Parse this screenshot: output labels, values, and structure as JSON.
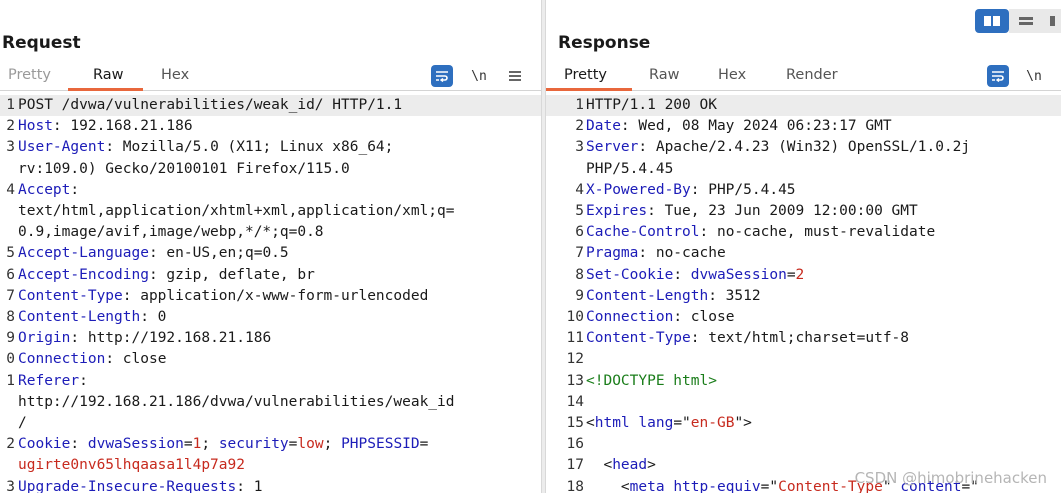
{
  "request": {
    "title": "Request",
    "tabs": [
      "Pretty",
      "Raw",
      "Hex"
    ],
    "active_tab": "Raw",
    "icons": {
      "wrap": "wrap-lines-icon",
      "newline": "\\n",
      "menu": "menu-icon"
    },
    "lines": [
      {
        "n": "1",
        "parts": [
          {
            "t": "POST /dvwa/vulnerabilities/weak_id/ HTTP/1.1",
            "c": "txt"
          }
        ],
        "hl": true
      },
      {
        "n": "2",
        "parts": [
          {
            "t": "Host",
            "c": "k"
          },
          {
            "t": ": 192.168.21.186",
            "c": "txt"
          }
        ]
      },
      {
        "n": "3",
        "parts": [
          {
            "t": "User-Agent",
            "c": "k"
          },
          {
            "t": ": Mozilla/5.0 (X11; Linux x86_64;",
            "c": "txt"
          }
        ]
      },
      {
        "n": "",
        "parts": [
          {
            "t": "rv:109.0) Gecko/20100101 Firefox/115.0",
            "c": "txt"
          }
        ]
      },
      {
        "n": "4",
        "parts": [
          {
            "t": "Accept",
            "c": "k"
          },
          {
            "t": ":",
            "c": "txt"
          }
        ]
      },
      {
        "n": "",
        "parts": [
          {
            "t": "text/html,application/xhtml+xml,application/xml;q=",
            "c": "txt"
          }
        ]
      },
      {
        "n": "",
        "parts": [
          {
            "t": "0.9,image/avif,image/webp,*/*;q=0.8",
            "c": "txt"
          }
        ]
      },
      {
        "n": "5",
        "parts": [
          {
            "t": "Accept-Language",
            "c": "k"
          },
          {
            "t": ": en-US,en;q=0.5",
            "c": "txt"
          }
        ]
      },
      {
        "n": "6",
        "parts": [
          {
            "t": "Accept-Encoding",
            "c": "k"
          },
          {
            "t": ": gzip, deflate, br",
            "c": "txt"
          }
        ]
      },
      {
        "n": "7",
        "parts": [
          {
            "t": "Content-Type",
            "c": "k"
          },
          {
            "t": ": application/x-www-form-urlencoded",
            "c": "txt"
          }
        ]
      },
      {
        "n": "8",
        "parts": [
          {
            "t": "Content-Length",
            "c": "k"
          },
          {
            "t": ": 0",
            "c": "txt"
          }
        ]
      },
      {
        "n": "9",
        "parts": [
          {
            "t": "Origin",
            "c": "k"
          },
          {
            "t": ": http://192.168.21.186",
            "c": "txt"
          }
        ]
      },
      {
        "n": "0",
        "parts": [
          {
            "t": "Connection",
            "c": "k"
          },
          {
            "t": ": close",
            "c": "txt"
          }
        ]
      },
      {
        "n": "1",
        "parts": [
          {
            "t": "Referer",
            "c": "k"
          },
          {
            "t": ":",
            "c": "txt"
          }
        ]
      },
      {
        "n": "",
        "parts": [
          {
            "t": "http://192.168.21.186/dvwa/vulnerabilities/weak_id",
            "c": "txt"
          }
        ]
      },
      {
        "n": "",
        "parts": [
          {
            "t": "/",
            "c": "txt"
          }
        ]
      },
      {
        "n": "2",
        "parts": [
          {
            "t": "Cookie",
            "c": "k"
          },
          {
            "t": ": ",
            "c": "txt"
          },
          {
            "t": "dvwaSession",
            "c": "k"
          },
          {
            "t": "=",
            "c": "txt"
          },
          {
            "t": "1",
            "c": "v"
          },
          {
            "t": "; ",
            "c": "txt"
          },
          {
            "t": "security",
            "c": "k"
          },
          {
            "t": "=",
            "c": "txt"
          },
          {
            "t": "low",
            "c": "v"
          },
          {
            "t": "; ",
            "c": "txt"
          },
          {
            "t": "PHPSESSID",
            "c": "k"
          },
          {
            "t": "=",
            "c": "txt"
          }
        ]
      },
      {
        "n": "",
        "parts": [
          {
            "t": "ugirte0nv65lhqaasa1l4p7a92",
            "c": "v"
          }
        ]
      },
      {
        "n": "3",
        "parts": [
          {
            "t": "Upgrade-Insecure-Requests",
            "c": "k"
          },
          {
            "t": ": 1",
            "c": "txt"
          }
        ]
      }
    ]
  },
  "response": {
    "title": "Response",
    "tabs": [
      "Pretty",
      "Raw",
      "Hex",
      "Render"
    ],
    "active_tab": "Pretty",
    "icons": {
      "wrap": "wrap-lines-icon",
      "newline": "\\n"
    },
    "lines": [
      {
        "n": "1",
        "parts": [
          {
            "t": "HTTP/1.1 200 OK",
            "c": "txt"
          }
        ],
        "hl": true
      },
      {
        "n": "2",
        "parts": [
          {
            "t": "Date",
            "c": "k"
          },
          {
            "t": ": Wed, 08 May 2024 06:23:17 GMT",
            "c": "txt"
          }
        ]
      },
      {
        "n": "3",
        "parts": [
          {
            "t": "Server",
            "c": "k"
          },
          {
            "t": ": Apache/2.4.23 (Win32) OpenSSL/1.0.2j",
            "c": "txt"
          }
        ]
      },
      {
        "n": "",
        "parts": [
          {
            "t": "PHP/5.4.45",
            "c": "txt"
          }
        ]
      },
      {
        "n": "4",
        "parts": [
          {
            "t": "X-Powered-By",
            "c": "k"
          },
          {
            "t": ": PHP/5.4.45",
            "c": "txt"
          }
        ]
      },
      {
        "n": "5",
        "parts": [
          {
            "t": "Expires",
            "c": "k"
          },
          {
            "t": ": Tue, 23 Jun 2009 12:00:00 GMT",
            "c": "txt"
          }
        ]
      },
      {
        "n": "6",
        "parts": [
          {
            "t": "Cache-Control",
            "c": "k"
          },
          {
            "t": ": no-cache, must-revalidate",
            "c": "txt"
          }
        ]
      },
      {
        "n": "7",
        "parts": [
          {
            "t": "Pragma",
            "c": "k"
          },
          {
            "t": ": no-cache",
            "c": "txt"
          }
        ]
      },
      {
        "n": "8",
        "parts": [
          {
            "t": "Set-Cookie",
            "c": "k"
          },
          {
            "t": ": ",
            "c": "txt"
          },
          {
            "t": "dvwaSession",
            "c": "k"
          },
          {
            "t": "=",
            "c": "txt"
          },
          {
            "t": "2",
            "c": "v"
          }
        ]
      },
      {
        "n": "9",
        "parts": [
          {
            "t": "Content-Length",
            "c": "k"
          },
          {
            "t": ": 3512",
            "c": "txt"
          }
        ]
      },
      {
        "n": "10",
        "parts": [
          {
            "t": "Connection",
            "c": "k"
          },
          {
            "t": ": close",
            "c": "txt"
          }
        ]
      },
      {
        "n": "11",
        "parts": [
          {
            "t": "Content-Type",
            "c": "k"
          },
          {
            "t": ": text/html;charset=utf-8",
            "c": "txt"
          }
        ]
      },
      {
        "n": "12",
        "parts": [
          {
            "t": "",
            "c": "txt"
          }
        ]
      },
      {
        "n": "13",
        "parts": [
          {
            "t": "<!DOCTYPE html>",
            "c": "t"
          }
        ]
      },
      {
        "n": "14",
        "parts": [
          {
            "t": "",
            "c": "txt"
          }
        ]
      },
      {
        "n": "15",
        "parts": [
          {
            "t": "<",
            "c": "txt"
          },
          {
            "t": "html",
            "c": "k"
          },
          {
            "t": " ",
            "c": "txt"
          },
          {
            "t": "lang",
            "c": "k"
          },
          {
            "t": "=\"",
            "c": "txt"
          },
          {
            "t": "en-GB",
            "c": "v"
          },
          {
            "t": "\">",
            "c": "txt"
          }
        ]
      },
      {
        "n": "16",
        "parts": [
          {
            "t": "",
            "c": "txt"
          }
        ]
      },
      {
        "n": "17",
        "parts": [
          {
            "t": "  <",
            "c": "txt"
          },
          {
            "t": "head",
            "c": "k"
          },
          {
            "t": ">",
            "c": "txt"
          }
        ]
      },
      {
        "n": "18",
        "parts": [
          {
            "t": "    <",
            "c": "txt"
          },
          {
            "t": "meta",
            "c": "k"
          },
          {
            "t": " ",
            "c": "txt"
          },
          {
            "t": "http-equiv",
            "c": "k"
          },
          {
            "t": "=\"",
            "c": "txt"
          },
          {
            "t": "Content-Type",
            "c": "v"
          },
          {
            "t": "\" ",
            "c": "txt"
          },
          {
            "t": "content",
            "c": "k"
          },
          {
            "t": "=\"",
            "c": "txt"
          }
        ]
      }
    ]
  },
  "view_toggle": {
    "active": "split-view-icon",
    "others": [
      "single-view-icon",
      "collapse-view-icon"
    ]
  },
  "watermark": "CSDN @himobrinehacken",
  "colors": {
    "accent": "#e8673c",
    "key": "#1c1cb8",
    "value": "#c72a1e",
    "doctype": "#1a7d1a",
    "button": "#2e6fbf"
  }
}
